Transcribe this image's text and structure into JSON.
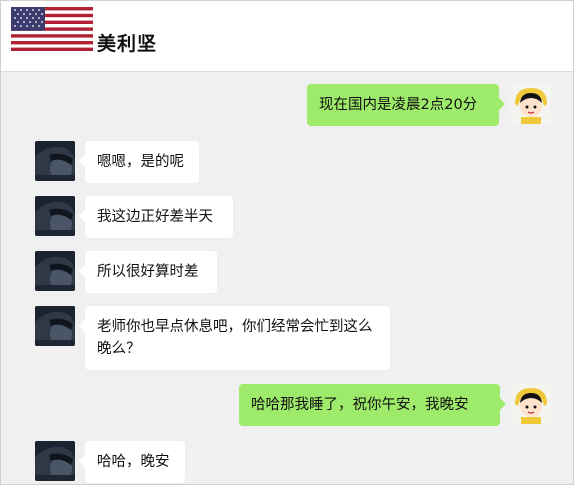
{
  "header": {
    "title": "美利坚",
    "flag_icon": "us-flag-icon"
  },
  "colors": {
    "background": "#f0f0f0",
    "incoming_bubble": "#ffffff",
    "outgoing_bubble": "#9eea6a"
  },
  "messages": [
    {
      "direction": "out",
      "text": "现在国内是凌晨2点20分"
    },
    {
      "direction": "in",
      "text": "嗯嗯，是的呢"
    },
    {
      "direction": "in",
      "text": "我这边正好差半天"
    },
    {
      "direction": "in",
      "text": "所以很好算时差"
    },
    {
      "direction": "in",
      "text": "老师你也早点休息吧，你们经常会忙到这么晚么？"
    },
    {
      "direction": "out",
      "text": "哈哈那我睡了，祝你午安，我晚安"
    },
    {
      "direction": "in",
      "text": "哈哈，晚安"
    }
  ]
}
